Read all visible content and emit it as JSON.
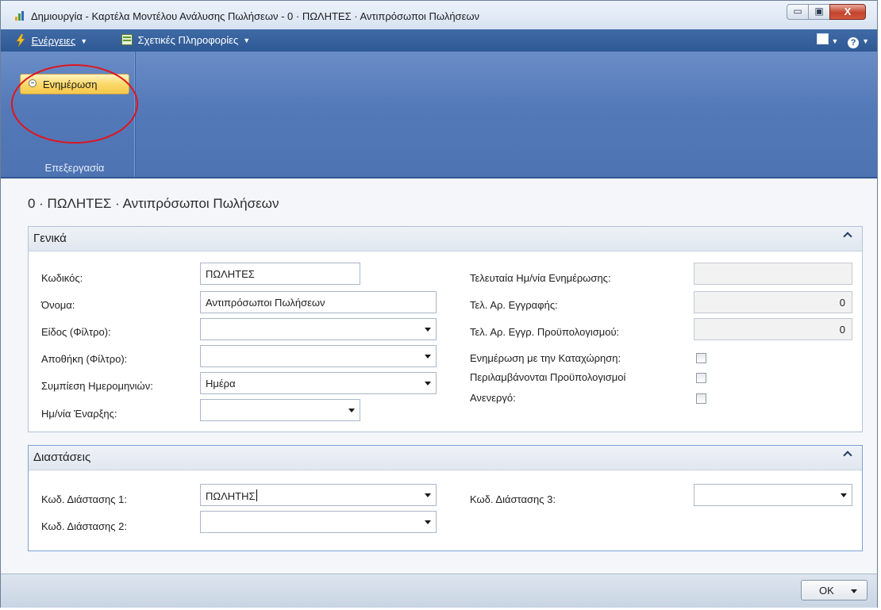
{
  "window": {
    "title": "Δημιουργία - Καρτέλα Μοντέλου Ανάλυσης Πωλήσεων - 0 · ΠΩΛΗΤΕΣ · Αντιπρόσωποι Πωλήσεων",
    "buttons": {
      "minimize": "▭",
      "maximize": "▣",
      "close": "X"
    }
  },
  "menubar": {
    "actions": "Ενέργειες",
    "related_info": "Σχετικές Πληροφορίες"
  },
  "ribbon": {
    "group_label": "Επεξεργασία",
    "update_button": "Ενημέρωση"
  },
  "page": {
    "title": "0 · ΠΩΛΗΤΕΣ · Αντιπρόσωποι Πωλήσεων"
  },
  "general": {
    "header": "Γενικά",
    "code_label": "Κωδικός:",
    "code_value": "ΠΩΛΗΤΕΣ",
    "name_label": "Όνομα:",
    "name_value": "Αντιπρόσωποι Πωλήσεων",
    "item_filter_label": "Είδος (Φίλτρο):",
    "item_filter_value": "",
    "location_filter_label": "Αποθήκη (Φίλτρο):",
    "location_filter_value": "",
    "date_compression_label": "Συμπίεση Ημερομηνιών:",
    "date_compression_value": "Ημέρα",
    "start_date_label": "Ημ/νία Έναρξης:",
    "start_date_value": "",
    "last_update_label": "Τελευταία Ημ/νία Ενημέρωσης:",
    "last_update_value": "",
    "last_entry_label": "Τελ. Αρ. Εγγραφής:",
    "last_entry_value": "0",
    "last_budget_entry_label": "Τελ. Αρ. Εγγρ. Προϋπολογισμού:",
    "last_budget_entry_value": "0",
    "update_on_posting_label": "Ενημέρωση με την Καταχώρηση:",
    "include_budgets_label": "Περιλαμβάνονται Προϋπολογισμοί",
    "blocked_label": "Ανενεργό:"
  },
  "dimensions": {
    "header": "Διαστάσεις",
    "dim1_label": "Κωδ. Διάστασης 1:",
    "dim1_value": "ΠΩΛΗΤΗΣ",
    "dim2_label": "Κωδ. Διάστασης 2:",
    "dim2_value": "",
    "dim3_label": "Κωδ. Διάστασης 3:",
    "dim3_value": ""
  },
  "footer": {
    "ok_label": "OK"
  },
  "colors": {
    "ribbon": "#5479b8",
    "menubar": "#2e5894",
    "highlight_button": "#fbd96a",
    "annotation_circle": "#e1141d"
  }
}
